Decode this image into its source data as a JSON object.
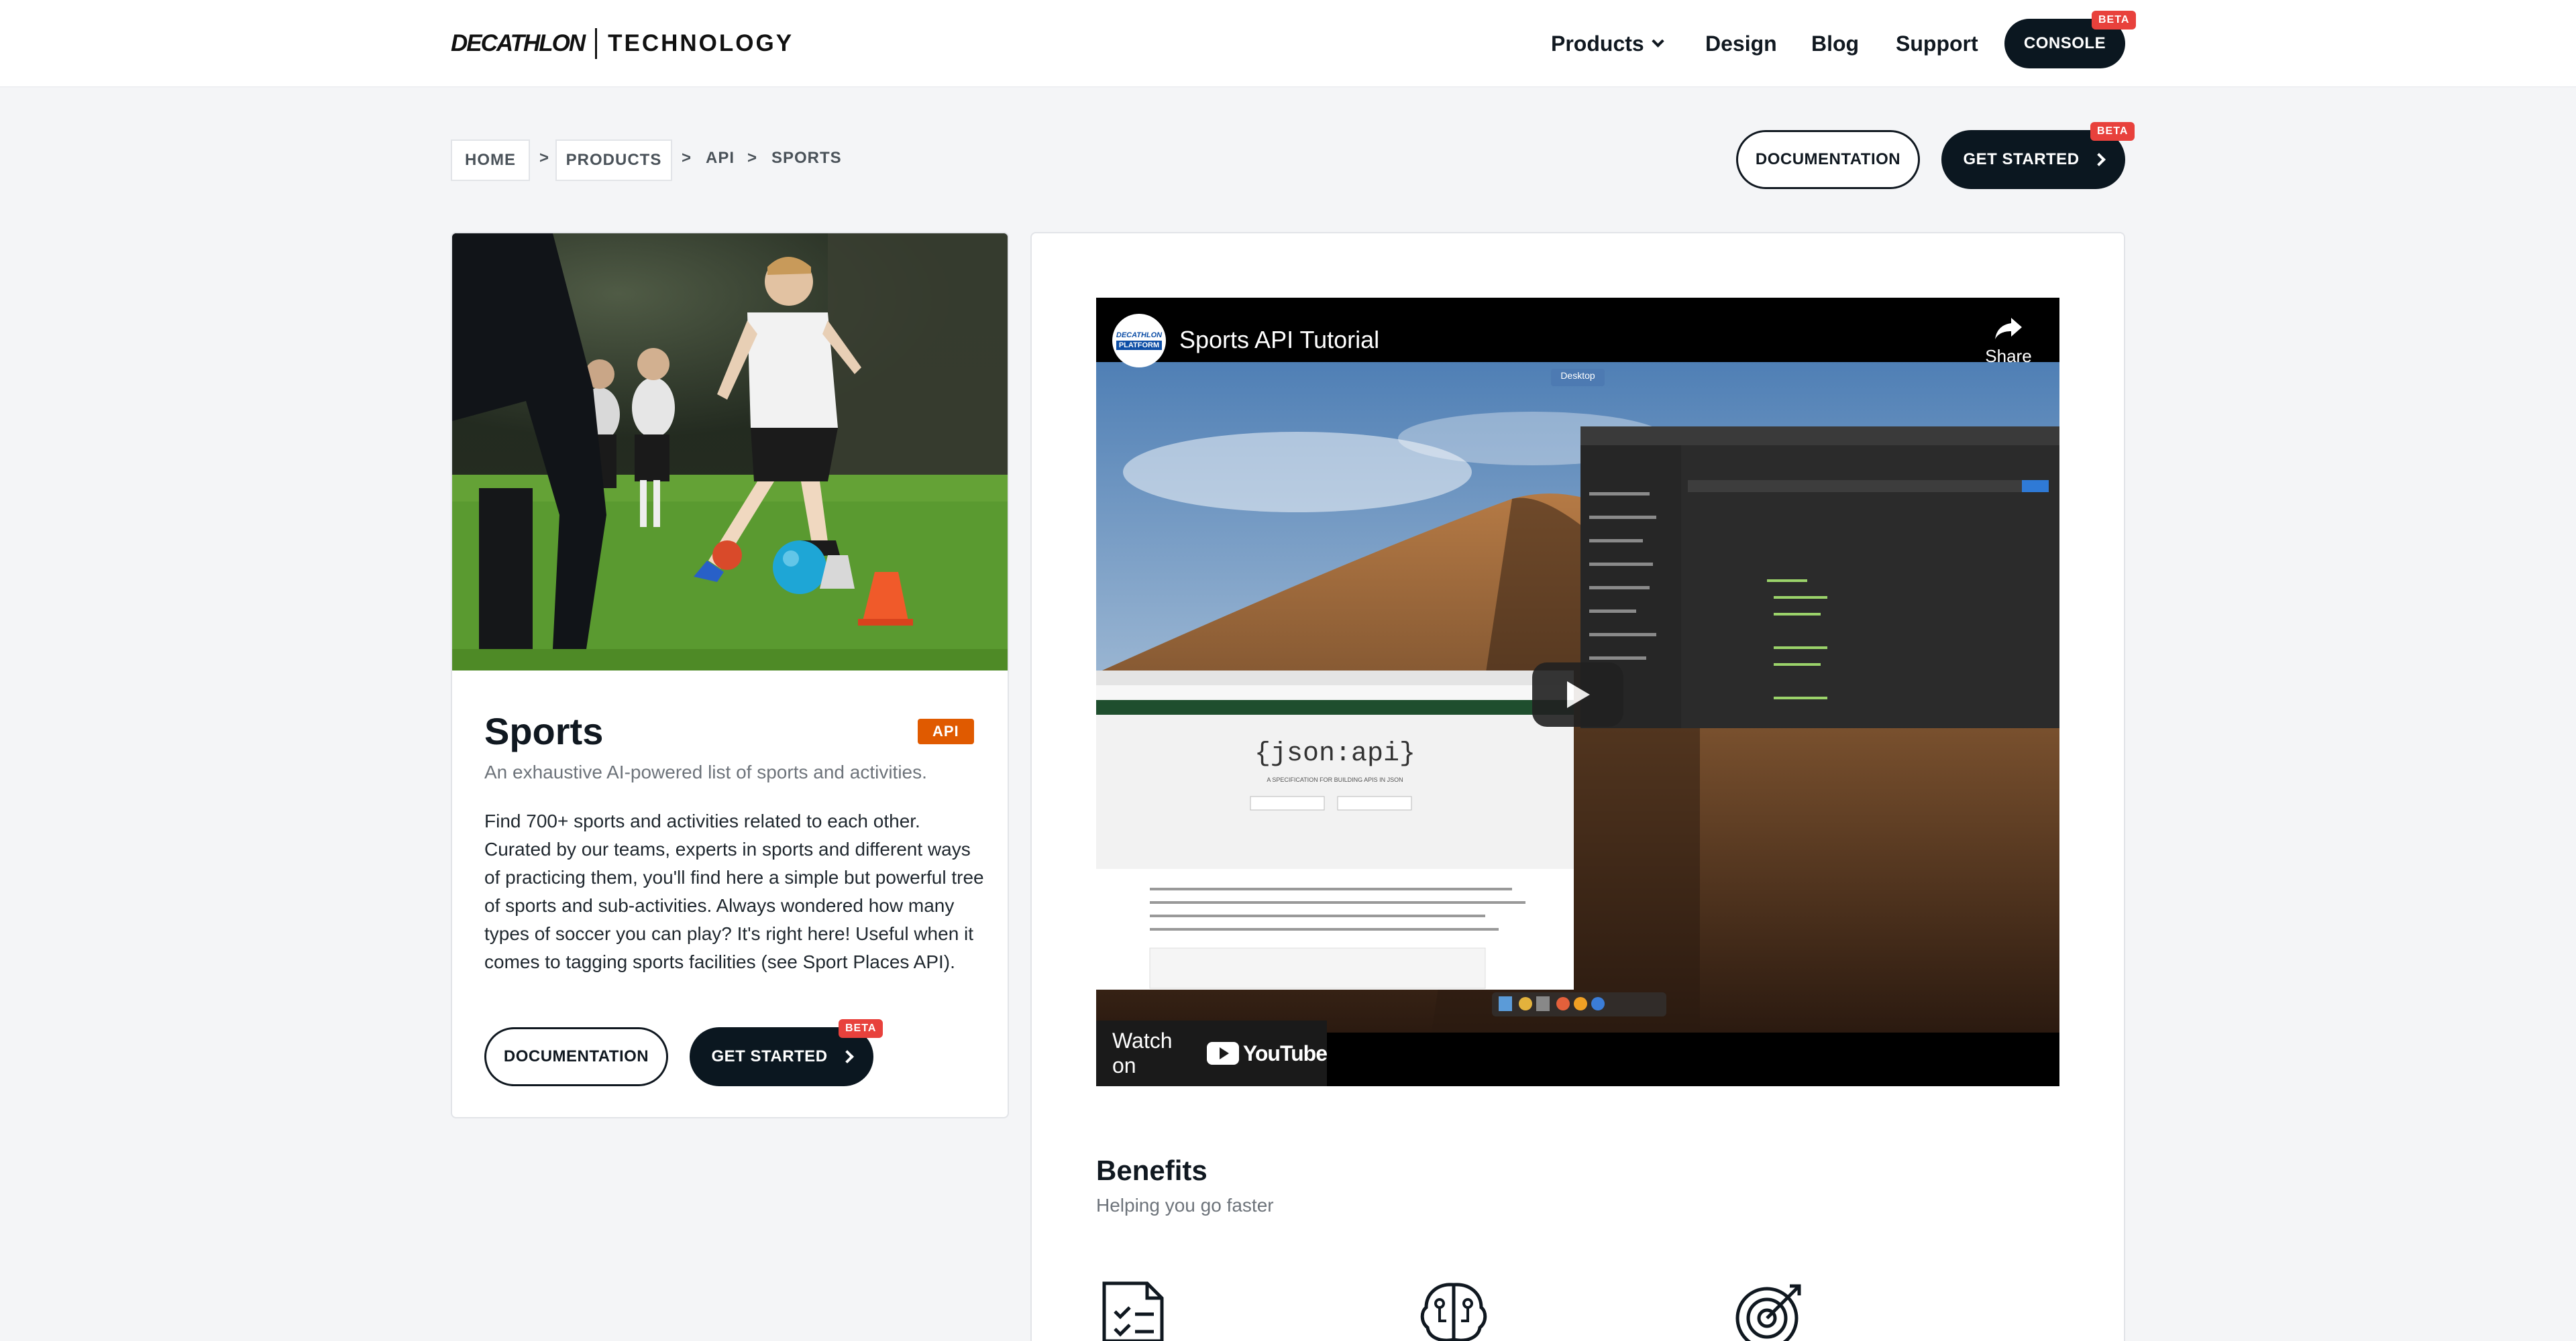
{
  "header": {
    "logo_brand": "DECATHLON",
    "logo_tech": "TECHNOLOGY",
    "nav": {
      "products": "Products",
      "design": "Design",
      "blog": "Blog",
      "support": "Support"
    },
    "console_label": "CONSOLE",
    "beta_label": "BETA"
  },
  "breadcrumb": {
    "home": "HOME",
    "products": "PRODUCTS",
    "api": "API",
    "sports": "SPORTS",
    "separator": ">"
  },
  "top_actions": {
    "documentation": "DOCUMENTATION",
    "get_started": "GET STARTED",
    "beta": "BETA"
  },
  "card": {
    "title": "Sports",
    "badge": "API",
    "subtitle": "An exhaustive AI-powered list of sports and activities.",
    "description": "Find 700+ sports and activities related to each other. Curated by our teams, experts in sports and different ways of practicing them, you'll find here a simple but powerful tree of sports and sub-activities. Always wondered how many types of soccer you can play? It's right here! Useful when it comes to tagging sports facilities (see Sport Places API).",
    "documentation": "DOCUMENTATION",
    "get_started": "GET STARTED",
    "beta": "BETA"
  },
  "video": {
    "title": "Sports API Tutorial",
    "channel_logo_line1": "DECATHLON",
    "channel_logo_line2": "PLATFORM",
    "share": "Share",
    "watch_on": "Watch on",
    "youtube": "YouTube",
    "desktop_label": "Desktop",
    "jsonapi_logo": "{json:api}",
    "jsonapi_tagline": "A SPECIFICATION FOR BUILDING APIS IN JSON"
  },
  "benefits": {
    "title": "Benefits",
    "subtitle": "Helping you go faster"
  },
  "colors": {
    "dark": "#0b1720",
    "beta": "#e8413c",
    "api_badge": "#e05a00",
    "page_bg": "#f4f5f7"
  }
}
